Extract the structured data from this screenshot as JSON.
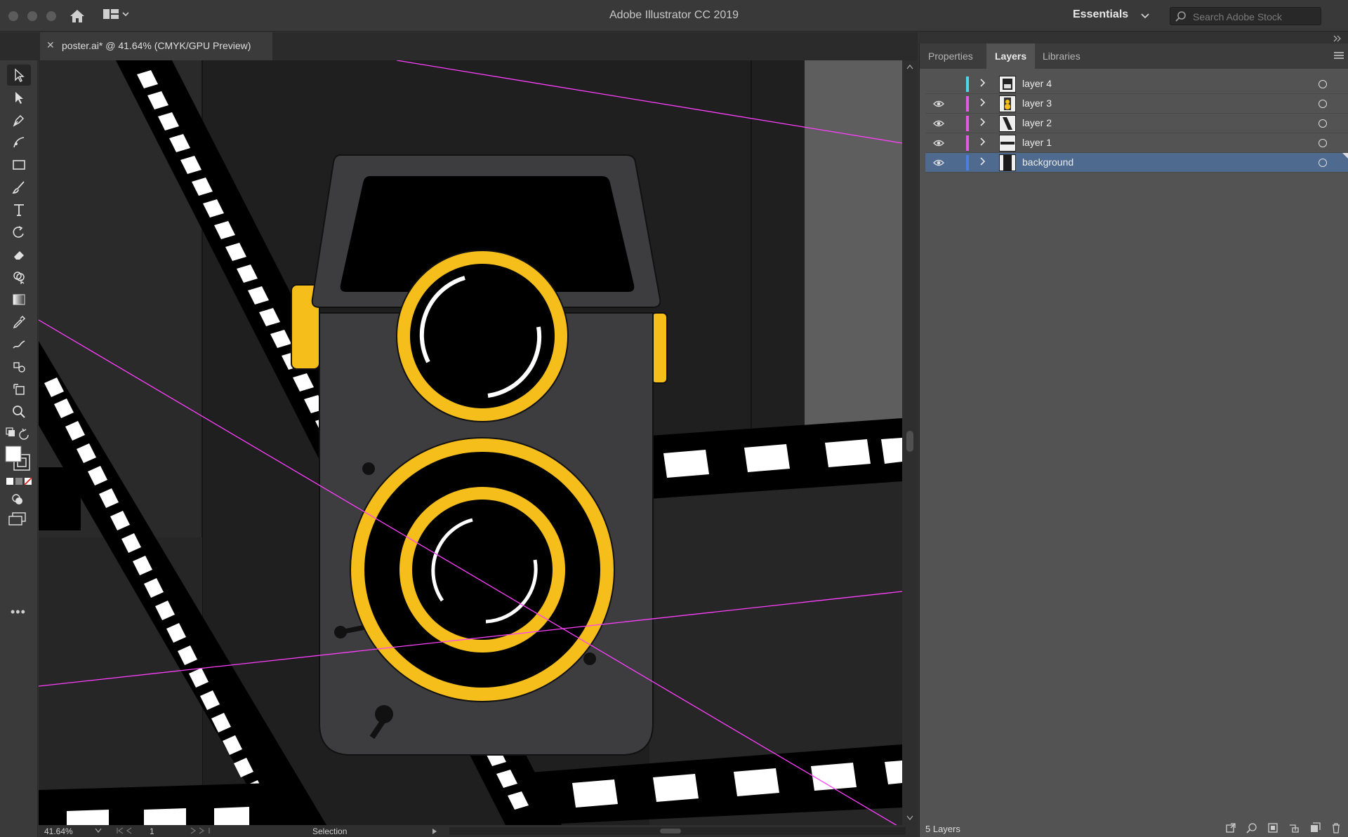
{
  "app": {
    "title": "Adobe Illustrator CC 2019",
    "workspace": "Essentials",
    "search_placeholder": "Search Adobe Stock"
  },
  "document": {
    "tab_label": "poster.ai* @ 41.64% (CMYK/GPU Preview)"
  },
  "tools": [
    "selection-tool",
    "direct-selection-tool",
    "pen-tool",
    "curvature-tool",
    "rectangle-tool",
    "paintbrush-tool",
    "type-tool",
    "rotate-tool",
    "eraser-tool",
    "shape-builder-tool",
    "gradient-tool",
    "eyedropper-tool",
    "blend-tool",
    "symbol-sprayer-tool",
    "artboard-tool",
    "zoom-tool"
  ],
  "panel": {
    "tabs": [
      "Properties",
      "Layers",
      "Libraries"
    ],
    "active_tab": "Layers",
    "layers": [
      {
        "name": "layer 4",
        "visible": false,
        "color": "#4fd6e8",
        "selected": false
      },
      {
        "name": "layer 3",
        "visible": true,
        "color": "#e05ce0",
        "selected": false
      },
      {
        "name": "layer 2",
        "visible": true,
        "color": "#e05ce0",
        "selected": false
      },
      {
        "name": "layer 1",
        "visible": true,
        "color": "#e05ce0",
        "selected": false
      },
      {
        "name": "background",
        "visible": true,
        "color": "#4d7fe0",
        "selected": true
      }
    ],
    "footer": "5 Layers"
  },
  "status": {
    "zoom": "41.64%",
    "page": "1",
    "mode": "Selection"
  },
  "colors": {
    "accent_yellow": "#f6be1a",
    "guide_magenta": "#ff40ff",
    "camera_body": "#3d3d40"
  }
}
